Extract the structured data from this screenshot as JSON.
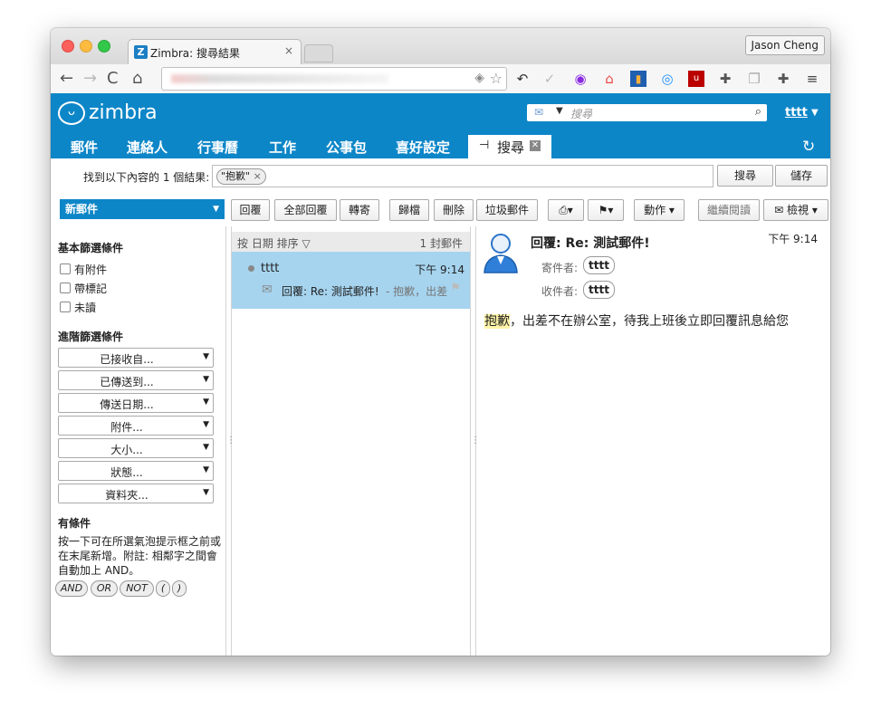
{
  "browser": {
    "tab_title": "Zimbra: 搜尋結果",
    "tab_close": "×",
    "profile_button": "Jason Cheng"
  },
  "zimbra": {
    "logo_text": "zimbra",
    "search_placeholder": "搜尋",
    "user": "tttt",
    "apps": [
      "郵件",
      "連絡人",
      "行事曆",
      "工作",
      "公事包",
      "喜好設定"
    ],
    "active_app": "搜尋",
    "result_label": "找到以下內容的 1 個結果:",
    "query_chip": "\"抱歉\"",
    "search_button": "搜尋",
    "save_button": "儲存"
  },
  "toolbar": {
    "new_mail": "新郵件",
    "reply": "回覆",
    "reply_all": "全部回覆",
    "forward": "轉寄",
    "archive": "歸檔",
    "delete": "刪除",
    "spam": "垃圾郵件",
    "actions": "動作",
    "continue_reading": "繼續閱讀",
    "view": "檢視"
  },
  "filters": {
    "basic_title": "基本篩選條件",
    "basic": [
      "有附件",
      "帶標記",
      "未讀"
    ],
    "advanced_title": "進階篩選條件",
    "advanced": [
      "已接收自...",
      "已傳送到...",
      "傳送日期...",
      "附件...",
      "大小...",
      "狀態...",
      "資料夾..."
    ],
    "conditions_title": "有條件",
    "conditions_note": "按一下可在所選氣泡提示框之前或在末尾新增。附註: 相鄰字之間會自動加上 AND。",
    "operators": [
      "AND",
      "OR",
      "NOT",
      "(",
      ")"
    ]
  },
  "list": {
    "sort_label": "按 日期 排序",
    "count": "1 封郵件",
    "items": [
      {
        "from": "tttt",
        "time": "下午 9:14",
        "subject": "回覆: Re: 測試郵件!",
        "fragment": "- 抱歉，出差"
      }
    ]
  },
  "message": {
    "subject": "回覆: Re: 測試郵件!",
    "time": "下午 9:14",
    "from_label": "寄件者:",
    "from": "tttt",
    "to_label": "收件者:",
    "to": "tttt",
    "body_highlight": "抱歉",
    "body_rest": "，出差不在辦公室，待我上班後立即回覆訊息給您"
  },
  "colors": {
    "zimbra_blue": "#0d86c8",
    "selected_row": "#a6d4ef",
    "highlight": "#fff4a8"
  }
}
